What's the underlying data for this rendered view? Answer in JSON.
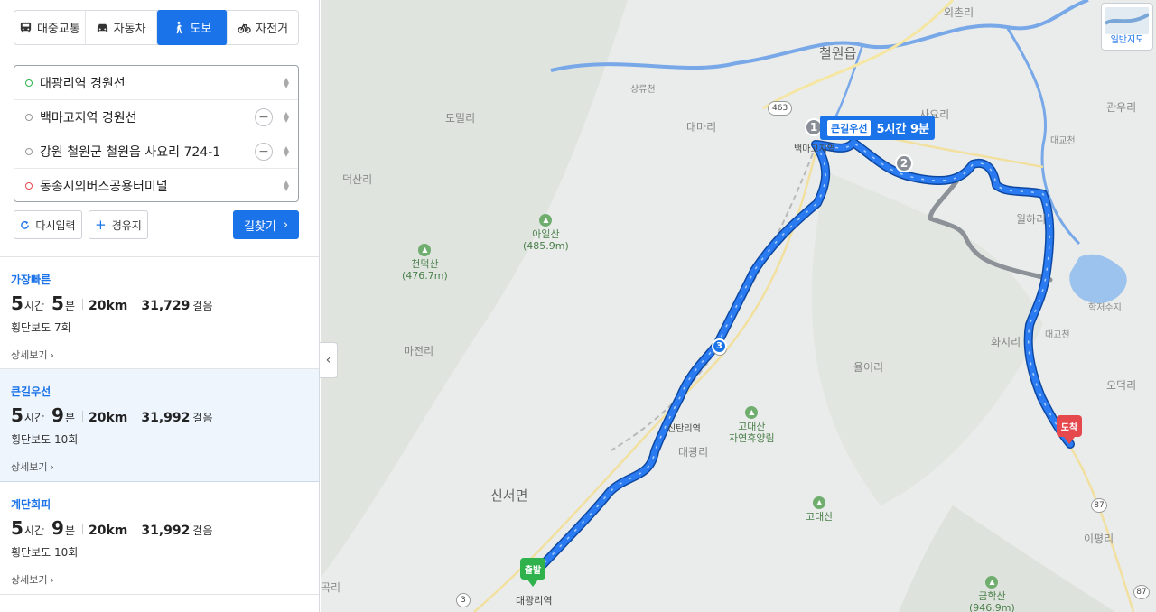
{
  "transport_modes": [
    {
      "label": "대중교통",
      "icon": "bus-icon",
      "active": false
    },
    {
      "label": "자동차",
      "icon": "car-icon",
      "active": false
    },
    {
      "label": "도보",
      "icon": "walk-icon",
      "active": true
    },
    {
      "label": "자전거",
      "icon": "bicycle-icon",
      "active": false
    }
  ],
  "waypoints": [
    {
      "text": "대광리역 경원선",
      "type": "start",
      "removable": false
    },
    {
      "text": "백마고지역 경원선",
      "type": "via",
      "removable": true
    },
    {
      "text": "강원 철원군 철원읍 사요리 724-1",
      "type": "via",
      "removable": true
    },
    {
      "text": "동송시외버스공용터미널",
      "type": "end",
      "removable": false
    }
  ],
  "actions": {
    "reset_label": "다시입력",
    "add_waypoint_label": "경유지",
    "search_label": "길찾기"
  },
  "routes": [
    {
      "label": "가장빠른",
      "hours": "5",
      "hours_unit": "시간",
      "minutes": "5",
      "minutes_unit": "분",
      "distance": "20km",
      "steps": "31,729",
      "steps_unit": "걸음",
      "crosswalk": "횡단보도 7회",
      "detail_label": "상세보기",
      "selected": false
    },
    {
      "label": "큰길우선",
      "hours": "5",
      "hours_unit": "시간",
      "minutes": "9",
      "minutes_unit": "분",
      "distance": "20km",
      "steps": "31,992",
      "steps_unit": "걸음",
      "crosswalk": "횡단보도 10회",
      "detail_label": "상세보기",
      "selected": true
    },
    {
      "label": "계단회피",
      "hours": "5",
      "hours_unit": "시간",
      "minutes": "9",
      "minutes_unit": "분",
      "distance": "20km",
      "steps": "31,992",
      "steps_unit": "걸음",
      "crosswalk": "횡단보도 10회",
      "detail_label": "상세보기",
      "selected": false
    }
  ],
  "map": {
    "route_tooltip": {
      "tag": "큰길우선",
      "time": "5시간 9분"
    },
    "waypoint_numbers": [
      "1",
      "2",
      "3"
    ],
    "start_pin": "출발",
    "end_pin": "도착",
    "layer_button": "일반지도",
    "places": [
      {
        "name": "철원읍",
        "size": "big"
      },
      {
        "name": "외촌리",
        "size": "small"
      },
      {
        "name": "상류천",
        "size": "small"
      },
      {
        "name": "도밀리",
        "size": "small"
      },
      {
        "name": "대마리",
        "size": "small"
      },
      {
        "name": "사요리",
        "size": "small"
      },
      {
        "name": "관우리",
        "size": "small"
      },
      {
        "name": "대교천",
        "size": "small"
      },
      {
        "name": "덕산리",
        "size": "small"
      },
      {
        "name": "월하리",
        "size": "small"
      },
      {
        "name": "학저수지",
        "size": "small"
      },
      {
        "name": "화지리",
        "size": "small"
      },
      {
        "name": "대교천",
        "size": "small"
      },
      {
        "name": "마전리",
        "size": "small"
      },
      {
        "name": "율이리",
        "size": "small"
      },
      {
        "name": "오덕리",
        "size": "small"
      },
      {
        "name": "대광리",
        "size": "small"
      },
      {
        "name": "신서면",
        "size": "big"
      },
      {
        "name": "이평리",
        "size": "small"
      },
      {
        "name": "곡리",
        "size": "small"
      },
      {
        "name": "백마고지역",
        "size": "small"
      },
      {
        "name": "신탄리역",
        "size": "small"
      },
      {
        "name": "대광리역",
        "size": "small"
      }
    ],
    "mountains": [
      {
        "name": "아일산",
        "elev": "(485.9m)"
      },
      {
        "name": "천덕산",
        "elev": "(476.7m)"
      },
      {
        "name": "고대산\n자연휴양림",
        "elev": ""
      },
      {
        "name": "고대산",
        "elev": ""
      },
      {
        "name": "금학산",
        "elev": "(946.9m)"
      }
    ],
    "road_badges": [
      "463",
      "3",
      "3",
      "87",
      "87"
    ]
  }
}
